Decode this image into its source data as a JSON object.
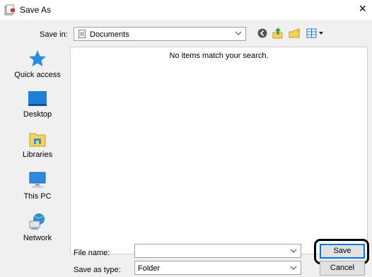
{
  "window": {
    "title": "Save As"
  },
  "toolbar": {
    "save_in_label": "Save in:",
    "save_in_value": "Documents"
  },
  "places": [
    {
      "label": "Quick access",
      "icon": "quick-access-icon"
    },
    {
      "label": "Desktop",
      "icon": "desktop-icon"
    },
    {
      "label": "Libraries",
      "icon": "libraries-icon"
    },
    {
      "label": "This PC",
      "icon": "this-pc-icon"
    },
    {
      "label": "Network",
      "icon": "network-icon"
    }
  ],
  "file_list": {
    "empty_message": "No items match your search."
  },
  "footer": {
    "file_name_label": "File name:",
    "file_name_value": "",
    "save_as_type_label": "Save as type:",
    "save_as_type_value": "Folder",
    "save_button": "Save",
    "cancel_button": "Cancel"
  },
  "colors": {
    "dialog_bg": "#f0f0f0",
    "accent_border": "#0078d7",
    "desktop_blue": "#1f7fd8",
    "folder_yellow": "#f7d35e"
  }
}
